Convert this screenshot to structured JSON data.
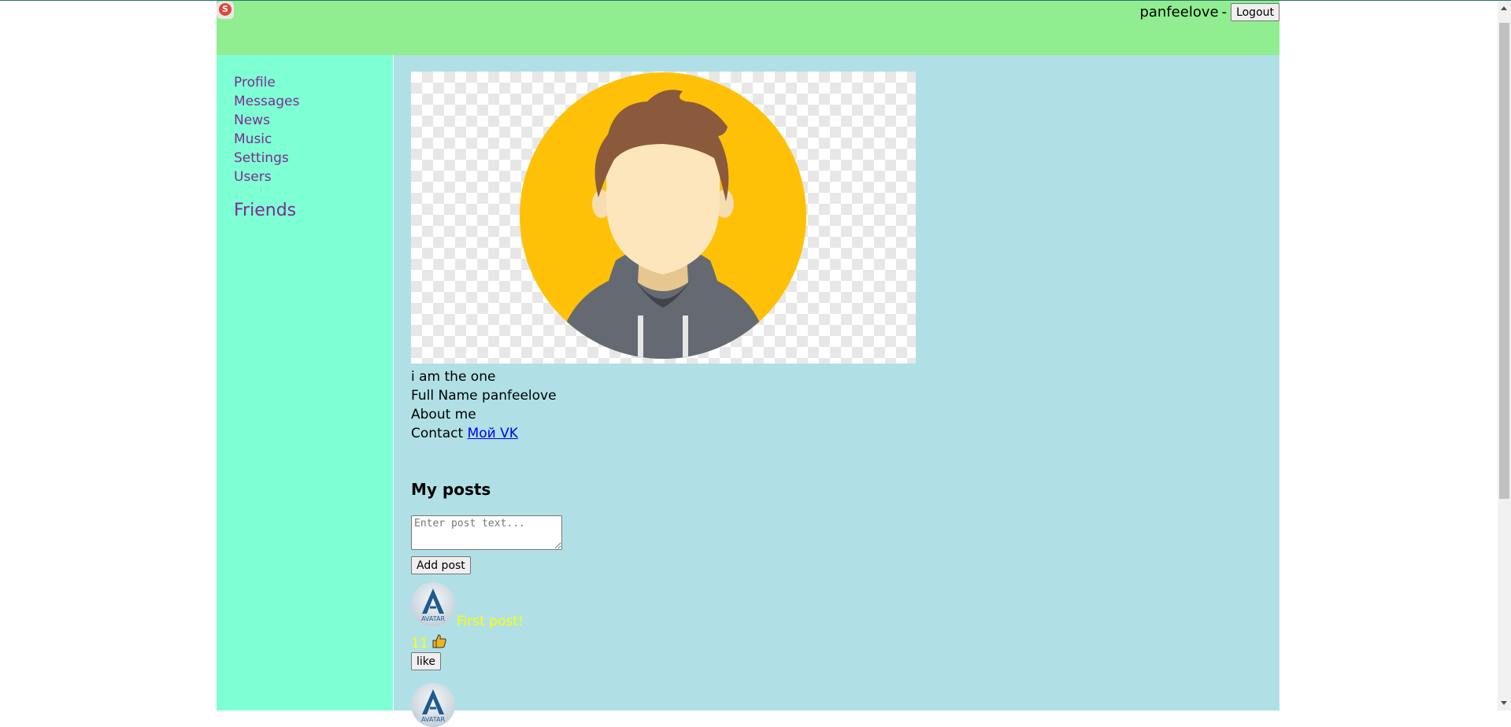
{
  "header": {
    "logo_letter": "S",
    "username": "panfeelove",
    "separator": "-",
    "logout_label": "Logout"
  },
  "sidebar": {
    "items": [
      {
        "label": "Profile"
      },
      {
        "label": "Messages"
      },
      {
        "label": "News"
      },
      {
        "label": "Music"
      },
      {
        "label": "Settings"
      },
      {
        "label": "Users"
      }
    ],
    "friends_label": "Friends"
  },
  "profile": {
    "status": "i am the one",
    "full_name_label": "Full Name",
    "full_name": "panfeelove",
    "about_label": "About me",
    "contact_label": "Contact",
    "contact_link": "Мой VK"
  },
  "posts": {
    "title": "My posts",
    "input_placeholder": "Enter post text...",
    "add_label": "Add post",
    "items": [
      {
        "text": "First post!",
        "likes": "11",
        "like_label": "like",
        "avatar_text": "AVATAR"
      },
      {
        "text": "",
        "likes": "",
        "like_label": "",
        "avatar_text": "AVATAR"
      }
    ]
  },
  "colors": {
    "header_bg": "#90ee90",
    "sidebar_bg": "#7fffd4",
    "content_bg": "#b0e0e6",
    "nav_link": "#7b2d8e",
    "post_text": "#ffff00",
    "contact_link": "#0000ee"
  }
}
